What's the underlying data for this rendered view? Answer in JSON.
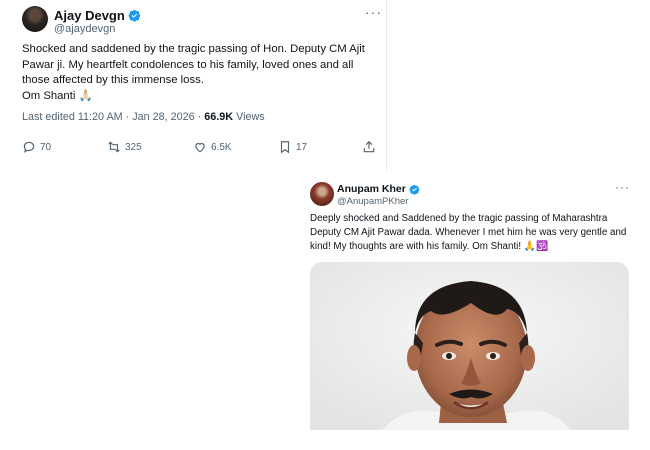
{
  "tweet1": {
    "author_name": "Ajay Devgn",
    "author_handle": "@ajaydevgn",
    "more_icon": "ellipsis-icon",
    "body_lines": [
      "Shocked and saddened by the tragic passing of Hon. Deputy CM Ajit Pawar ji. My heartfelt condolences to his family, loved ones and all those affected by this immense loss.",
      "Om Shanti 🙏🏻"
    ],
    "meta": {
      "edited": "Last edited 11:20 AM · Jan 28, 2026 · ",
      "views_count": "66.9K",
      "views_label": " Views"
    },
    "actions": {
      "replies": "70",
      "reposts": "325",
      "likes": "6.5K",
      "bookmarks": "17"
    }
  },
  "tweet2": {
    "author_name": "Anupam Kher",
    "author_handle": "@AnupamPKher",
    "more_icon": "ellipsis-icon",
    "body": "Deeply shocked and Saddened by the tragic passing of Maharashtra Deputy CM Ajit Pawar dada. Whenever I met him he was very gentle and kind! My thoughts are with his family. Om Shanti! 🙏🕉️",
    "image": "photo of Ajit Pawar"
  },
  "colors": {
    "verified_blue": "#1d9bf0",
    "secondary_text": "#536471",
    "primary_text": "#0f1419"
  }
}
